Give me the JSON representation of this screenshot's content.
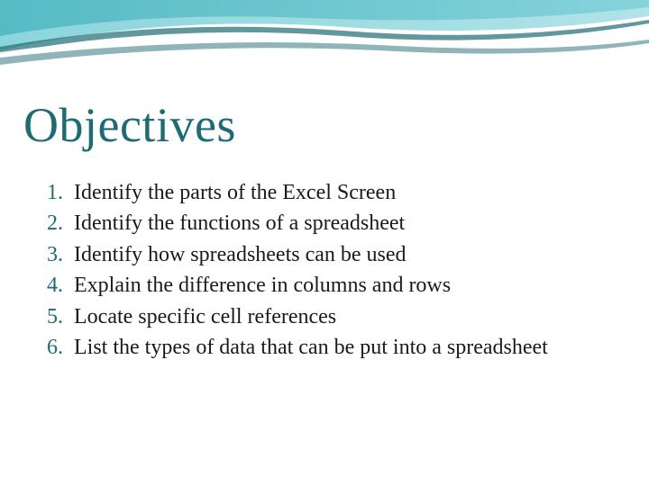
{
  "title": "Objectives",
  "objectives": [
    "Identify the parts of the Excel Screen",
    "Identify the functions of a spreadsheet",
    "Identify how spreadsheets can be used",
    "Explain the difference in columns and rows",
    "Locate specific cell references",
    "List the types of data that can be put into a spreadsheet"
  ]
}
